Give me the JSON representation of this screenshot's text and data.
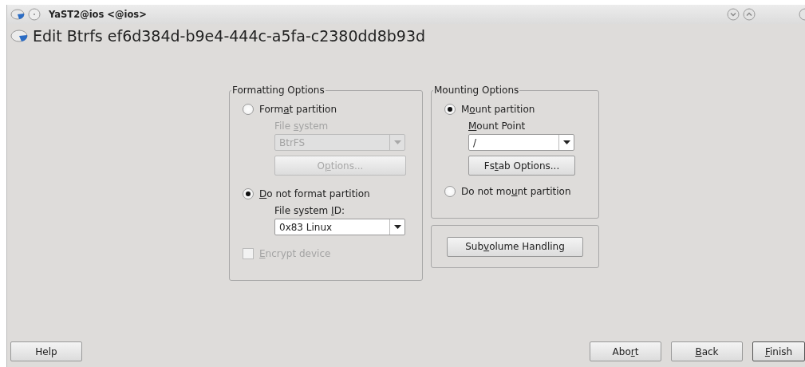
{
  "window": {
    "title": "YaST2@ios <@ios>"
  },
  "heading": "Edit Btrfs ef6d384d-b9e4-444c-a5fa-c2380dd8b93d",
  "formatting": {
    "title": "Formatting Options",
    "format_radio": {
      "label": {
        "before": "Form",
        "key": "a",
        "after": "t partition"
      },
      "selected": false
    },
    "file_system_label": {
      "label": {
        "before": "File ",
        "key": "s",
        "after": "ystem"
      },
      "disabled": true
    },
    "file_system_combo": {
      "value": "BtrFS",
      "disabled": true
    },
    "options_button": {
      "label": {
        "before": "O",
        "key": "p",
        "after": "tions..."
      },
      "disabled": true
    },
    "no_format_radio": {
      "label": {
        "key": "D",
        "after": "o not format partition"
      },
      "selected": true
    },
    "fs_id_label": {
      "label": {
        "before": "File system ",
        "key": "I",
        "after": "D:"
      },
      "disabled": false
    },
    "fs_id_combo": {
      "value": "0x83 Linux",
      "disabled": false
    },
    "encrypt_checkbox": {
      "label": {
        "key": "E",
        "after": "ncrypt device"
      },
      "checked": false,
      "disabled": true
    }
  },
  "mounting": {
    "title": "Mounting Options",
    "mount_radio": {
      "label": {
        "before": "M",
        "key": "o",
        "after": "unt partition"
      },
      "selected": true
    },
    "mount_point_label": {
      "label": {
        "key": "M",
        "after": "ount Point"
      },
      "disabled": false
    },
    "mount_point_combo": {
      "value": "/",
      "disabled": false
    },
    "fstab_button": {
      "label": {
        "before": "Fs",
        "key": "t",
        "after": "ab Options..."
      },
      "disabled": false
    },
    "no_mount_radio": {
      "label": {
        "before": "Do not mo",
        "key": "u",
        "after": "nt partition"
      },
      "selected": false
    }
  },
  "subvolume_button": {
    "label": {
      "before": "Sub",
      "key": "v",
      "after": "olume Handling"
    },
    "disabled": false
  },
  "buttons": [
    {
      "label": {
        "before": "Help"
      },
      "kind": "left"
    },
    {
      "label": {
        "before": "Abo",
        "key": "r",
        "after": "t"
      },
      "kind": "right"
    },
    {
      "label": {
        "key": "B",
        "after": "ack"
      },
      "kind": "right"
    },
    {
      "label": {
        "key": "F",
        "after": "inish"
      },
      "kind": "right"
    }
  ]
}
